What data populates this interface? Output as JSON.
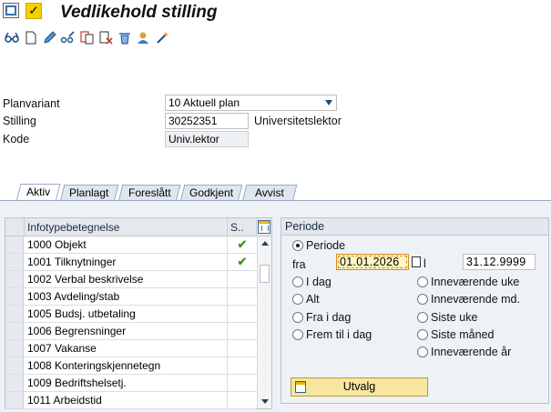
{
  "window": {
    "title": "Vedlikehold stilling"
  },
  "toolbar": {
    "icons": [
      "glasses-icon",
      "new-doc-icon",
      "pencil-icon",
      "glasses-pencil-icon",
      "copy-icon",
      "delimit-icon",
      "trash-icon",
      "person-icon",
      "wand-icon"
    ]
  },
  "form": {
    "planvariant_label": "Planvariant",
    "planvariant_value": "10 Aktuell plan",
    "stilling_label": "Stilling",
    "stilling_value": "30252351",
    "stilling_text": "Universitetslektor",
    "kode_label": "Kode",
    "kode_value": "Univ.lektor"
  },
  "tabs": [
    {
      "label": "Aktiv",
      "active": true
    },
    {
      "label": "Planlagt",
      "active": false
    },
    {
      "label": "Foreslått",
      "active": false
    },
    {
      "label": "Godkjent",
      "active": false
    },
    {
      "label": "Avvist",
      "active": false
    }
  ],
  "table": {
    "headers": {
      "name": "Infotypebetegnelse",
      "status": "S.."
    },
    "rows": [
      {
        "name": "1000 Objekt",
        "status": "✔"
      },
      {
        "name": "1001 Tilknytninger",
        "status": "✔"
      },
      {
        "name": "1002 Verbal beskrivelse",
        "status": ""
      },
      {
        "name": "1003 Avdeling/stab",
        "status": ""
      },
      {
        "name": "1005 Budsj. utbetaling",
        "status": ""
      },
      {
        "name": "1006 Begrensninger",
        "status": ""
      },
      {
        "name": "1007 Vakanse",
        "status": ""
      },
      {
        "name": "1008 Konteringskjennetegn",
        "status": ""
      },
      {
        "name": "1009 Bedriftshelsetj.",
        "status": ""
      },
      {
        "name": "1011 Arbeidstid",
        "status": ""
      }
    ]
  },
  "periode": {
    "title": "Periode",
    "periode_label": "Periode",
    "fra_label": "fra",
    "from_date": "01.01.2026",
    "til_label": "l",
    "to_date": "31.12.9999",
    "left_options": [
      "I dag",
      "Alt",
      "Fra i dag",
      "Frem til i dag"
    ],
    "right_options": [
      "Inneværende uke",
      "Inneværende md.",
      "Siste uke",
      "Siste måned",
      "Inneværende år"
    ],
    "selected": "Periode",
    "button_label": "Utvalg"
  },
  "colors": {
    "accent": "#1a4e8a",
    "check": "#3f9a1f",
    "button": "#f6e6a0",
    "highlight": "#fff6c2"
  }
}
